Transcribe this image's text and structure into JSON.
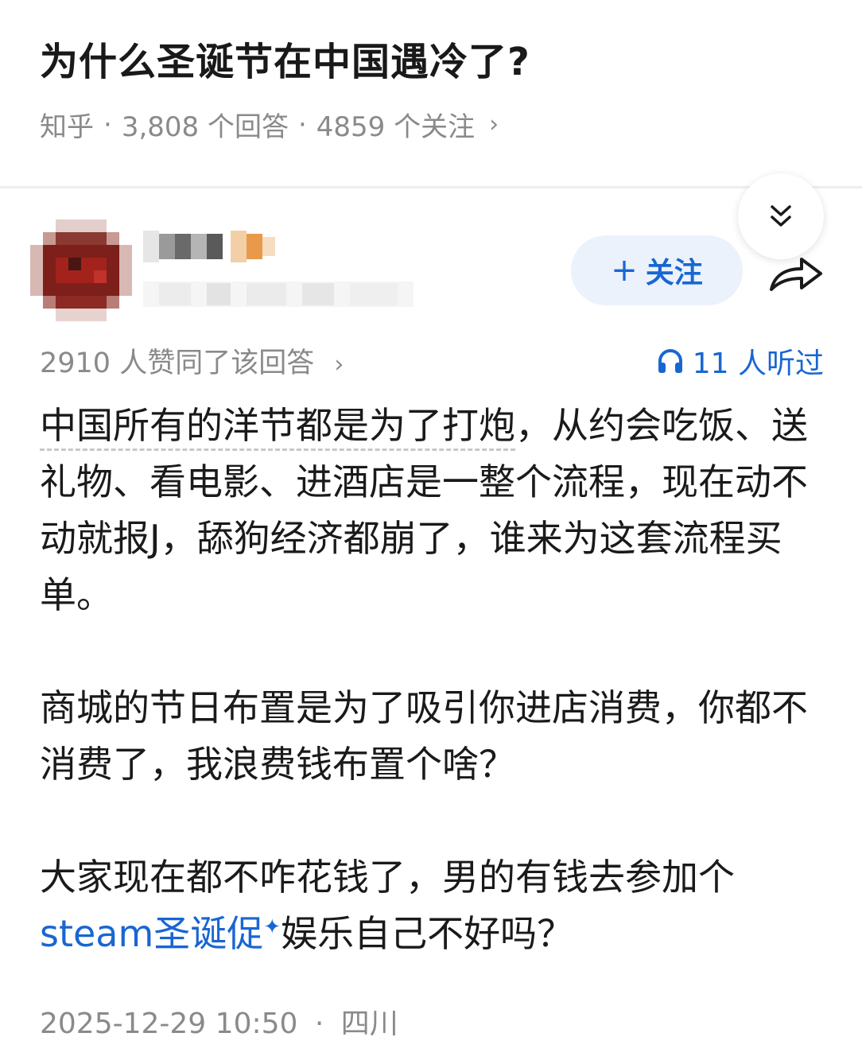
{
  "question": {
    "title": "为什么圣诞节在中国遇冷了?",
    "source": "知乎",
    "separator": "·",
    "answers_count": "3,808 个回答",
    "follow_count": "4859 个关注",
    "chevron": "›"
  },
  "author": {
    "follow_plus": "+",
    "follow_label": "关注"
  },
  "stats": {
    "upvotes_text": "2910 人赞同了该回答",
    "chevron": "›",
    "listened_text": "11 人听过"
  },
  "answer": {
    "p1_underlined": "中国所有的洋节都是为了打炮",
    "p1_rest": "，从约会吃饭、送礼物、看电影、进酒店是一整个流程，现在动不动就报J，舔狗经济都崩了，谁来为这套流程买单。",
    "p2": "商城的节日布置是为了吸引你进店消费，你都不消费了，我浪费钱布置个啥？",
    "p3_start": "大家现在都不咋花钱了，男的有钱去参加个",
    "p3_link": "steam圣诞促",
    "p3_sparkle": "✦",
    "p3_end": "娱乐自己不好吗？"
  },
  "footer": {
    "datetime": "2025-12-29 10:50",
    "separator": "·",
    "location": "四川"
  },
  "colors": {
    "accent_blue": "#1966d2",
    "follow_bg": "#ebf2fc",
    "meta_gray": "#8a8a8a",
    "text": "#1a1a1a"
  },
  "icons": {
    "collapse": "double-chevron-down-icon",
    "share": "share-arrow-icon",
    "listen": "headphones-icon"
  }
}
